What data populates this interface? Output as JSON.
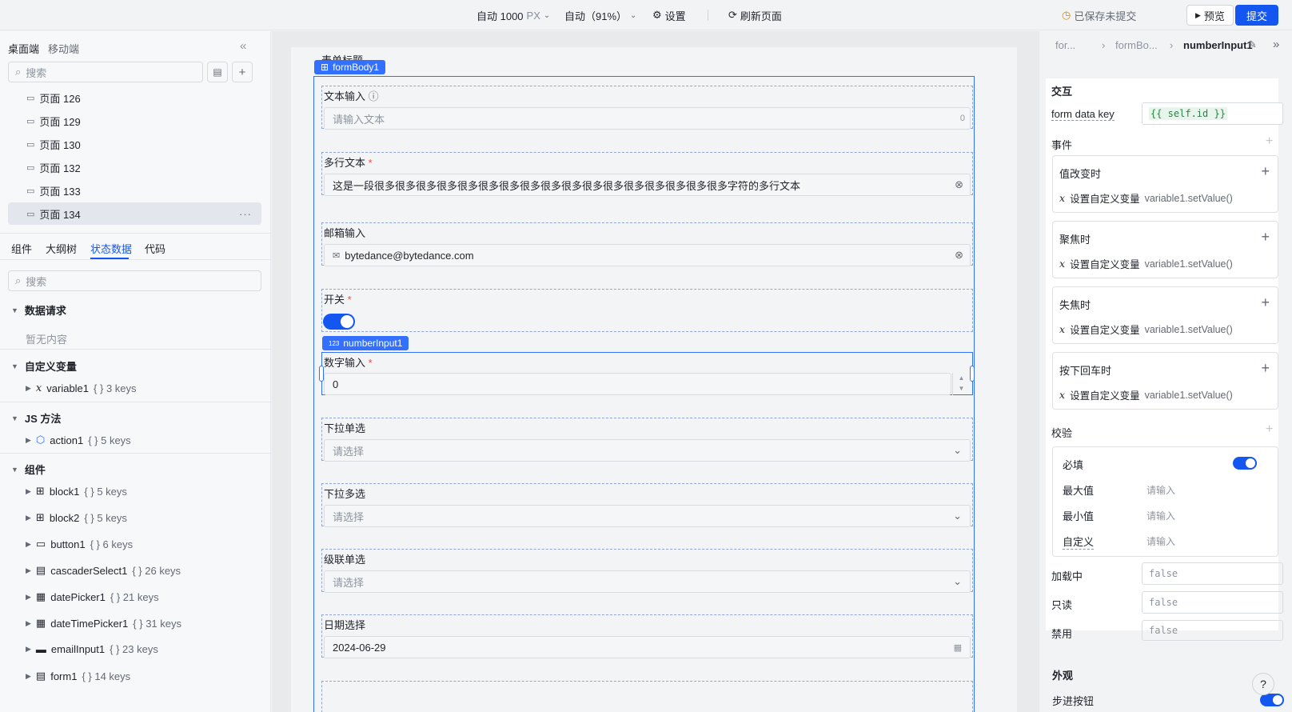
{
  "topbar": {
    "width_label": "自动 1000",
    "width_unit": "PX",
    "zoom_label": "自动（91%）",
    "settings_label": "设置",
    "refresh_label": "刷新页面",
    "save_status": "已保存未提交",
    "preview_label": "预览",
    "submit_label": "提交"
  },
  "left": {
    "tabs": [
      "桌面端",
      "移动端"
    ],
    "search_placeholder": "搜索",
    "pages": [
      "页面 126",
      "页面 129",
      "页面 130",
      "页面 132",
      "页面 133",
      "页面 134"
    ],
    "selected_page": "页面 134",
    "bottom_tabs": [
      "组件",
      "大纲树",
      "状态数据",
      "代码"
    ],
    "active_bottom_tab": "状态数据",
    "state_search_placeholder": "搜索",
    "sections": {
      "data_request": "数据请求",
      "empty": "暂无内容",
      "custom_var": "自定义变量",
      "js_method": "JS 方法",
      "components": "组件"
    },
    "variables": [
      {
        "name": "variable1",
        "keys": "{ } 3 keys"
      }
    ],
    "methods": [
      {
        "name": "action1",
        "keys": "{ } 5 keys"
      }
    ],
    "components": [
      {
        "name": "block1",
        "keys": "{ } 5 keys"
      },
      {
        "name": "block2",
        "keys": "{ } 5 keys"
      },
      {
        "name": "button1",
        "keys": "{ } 6 keys"
      },
      {
        "name": "cascaderSelect1",
        "keys": "{ } 26 keys"
      },
      {
        "name": "datePicker1",
        "keys": "{ } 21 keys"
      },
      {
        "name": "dateTimePicker1",
        "keys": "{ } 31 keys"
      },
      {
        "name": "emailInput1",
        "keys": "{ } 23 keys"
      },
      {
        "name": "form1",
        "keys": "{ } 14 keys"
      }
    ]
  },
  "canvas": {
    "form_title": "表单标题",
    "form_body_tag": "formBody1",
    "number_tag": "numberInput1",
    "fields": {
      "text": {
        "label": "文本输入",
        "placeholder": "请输入文本",
        "count": "0"
      },
      "multiline": {
        "label": "多行文本",
        "value": "这是一段很多很多很多很多很多很多很多很多很多很多很多很多很多很多很多很多很多字符的多行文本"
      },
      "email": {
        "label": "邮箱输入",
        "value": "bytedance@bytedance.com"
      },
      "switch": {
        "label": "开关",
        "on": true
      },
      "number": {
        "label": "数字输入",
        "value": "0"
      },
      "select": {
        "label": "下拉单选",
        "placeholder": "请选择"
      },
      "multiselect": {
        "label": "下拉多选",
        "placeholder": "请选择"
      },
      "cascader": {
        "label": "级联单选",
        "placeholder": "请选择"
      },
      "date": {
        "label": "日期选择",
        "value": "2024-06-29"
      }
    }
  },
  "right": {
    "breadcrumb": [
      "for...",
      "formBo...",
      "numberInput1"
    ],
    "interaction_title": "交互",
    "form_data_key_label": "form data key",
    "form_data_key_value": "{{ self.id }}",
    "events_title": "事件",
    "events": [
      {
        "name": "值改变时",
        "action": "设置自定义变量",
        "fn": "variable1.setValue()"
      },
      {
        "name": "聚焦时",
        "action": "设置自定义变量",
        "fn": "variable1.setValue()"
      },
      {
        "name": "失焦时",
        "action": "设置自定义变量",
        "fn": "variable1.setValue()"
      },
      {
        "name": "按下回车时",
        "action": "设置自定义变量",
        "fn": "variable1.setValue()"
      }
    ],
    "validation_title": "校验",
    "required_label": "必填",
    "max_label": "最大值",
    "min_label": "最小值",
    "custom_label": "自定义",
    "input_placeholder": "请输入",
    "loading_label": "加载中",
    "readonly_label": "只读",
    "disabled_label": "禁用",
    "false_value": "false",
    "appearance_title": "外观",
    "stepper_label": "步进按钮",
    "help_icon": "?"
  }
}
